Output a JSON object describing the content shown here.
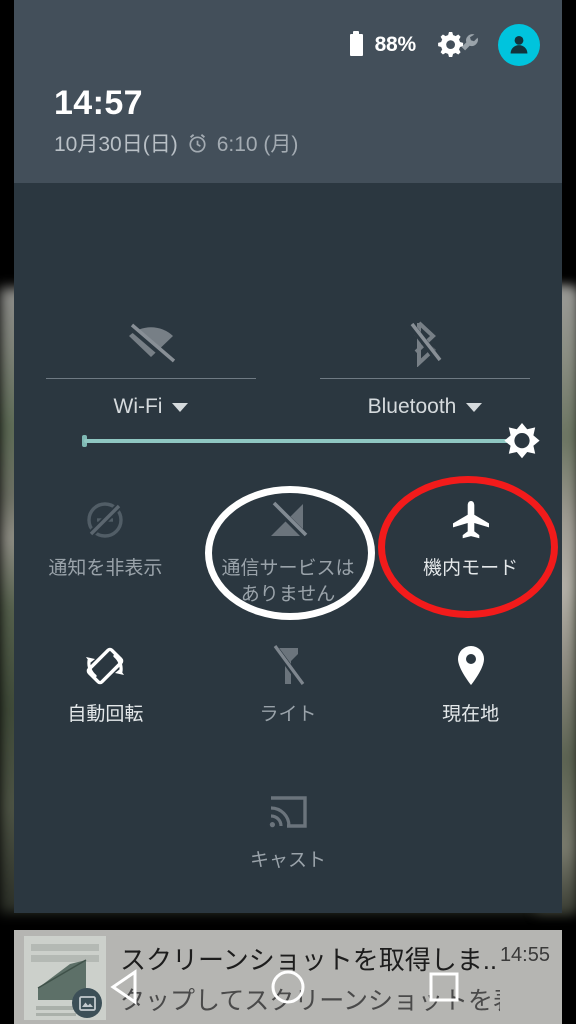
{
  "statusbar": {
    "battery_icon": "battery-icon",
    "battery_percent": "88%",
    "settings_icon": "gear-wrench-icon",
    "avatar_icon": "user-avatar-icon",
    "avatar_color": "#00c4dd"
  },
  "header": {
    "clock": "14:57",
    "date": "10月30日(日)",
    "alarm_icon": "alarm-clock-icon",
    "alarm_time": "6:10 (月)"
  },
  "brightness": {
    "icon": "brightness-sun-icon",
    "value_percent": 97,
    "track_color": "#8fc7c2"
  },
  "dual_tiles": [
    {
      "label": "Wi-Fi",
      "icon": "wifi-off-icon",
      "state": "off",
      "has_caret": true
    },
    {
      "label": "Bluetooth",
      "icon": "bluetooth-off-icon",
      "state": "off",
      "has_caret": true
    }
  ],
  "tiles": [
    {
      "label": "通知を非表示",
      "icon": "do-not-disturb-icon",
      "state": "off"
    },
    {
      "label": "通信サービスはありません",
      "icon": "cellular-off-icon",
      "state": "off"
    },
    {
      "label": "機内モード",
      "icon": "airplane-mode-icon",
      "state": "on"
    },
    {
      "label": "自動回転",
      "icon": "auto-rotate-icon",
      "state": "on"
    },
    {
      "label": "ライト",
      "icon": "flashlight-icon",
      "state": "off"
    },
    {
      "label": "現在地",
      "icon": "location-pin-icon",
      "state": "on"
    },
    {
      "label": "キャスト",
      "icon": "cast-icon",
      "state": "off"
    }
  ],
  "annotations": [
    {
      "shape": "ellipse",
      "color": "#ffffff",
      "target": "通信サービスはありません"
    },
    {
      "shape": "ellipse",
      "color": "#f21b1b",
      "target": "機内モード"
    }
  ],
  "notification": {
    "title": "スクリーンショットを取得しま..",
    "body": "タップしてスクリーンショットを表示しま..",
    "time": "14:55",
    "thumbnail_icon": "screenshot-thumbnail",
    "badge_icon": "image-icon"
  },
  "navbar": {
    "back": "back-triangle-icon",
    "home": "home-circle-icon",
    "recents": "recents-square-icon"
  }
}
